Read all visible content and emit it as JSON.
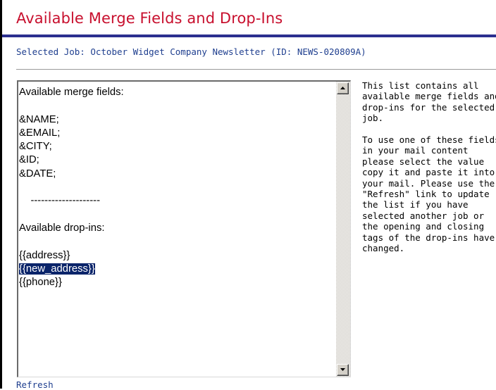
{
  "page": {
    "title": "Available Merge Fields and Drop-Ins",
    "selected_job": "Selected Job: October Widget Company Newsletter (ID: NEWS-020809A)"
  },
  "textbox": {
    "lines": [
      "Available merge fields:",
      "",
      "&NAME;",
      "&EMAIL;",
      "&CITY;",
      "&ID;",
      "&DATE;",
      "",
      "    --------------------",
      "",
      "Available drop-ins:",
      "",
      "{{address}}",
      "{{new_address}}",
      "{{phone}}"
    ],
    "selected_line": "{{new_address}}"
  },
  "help": {
    "paragraph1": "This list contains all available merge fields and drop-ins for the selected job.",
    "paragraph2": "To use one of these fields in your mail content please select the value copy it and paste it into your mail. Please use the \"Refresh\" link to update the list if you have selected another job or the opening and closing tags of the drop-ins have changed."
  },
  "links": {
    "refresh": "Refresh"
  },
  "colors": {
    "title": "#c8102e",
    "rule": "#2b2f8f",
    "link_text": "#1f3f8f",
    "selection": "#0a246a"
  },
  "icons": {
    "scroll_up": "triangle-up-icon",
    "scroll_down": "triangle-down-icon"
  }
}
